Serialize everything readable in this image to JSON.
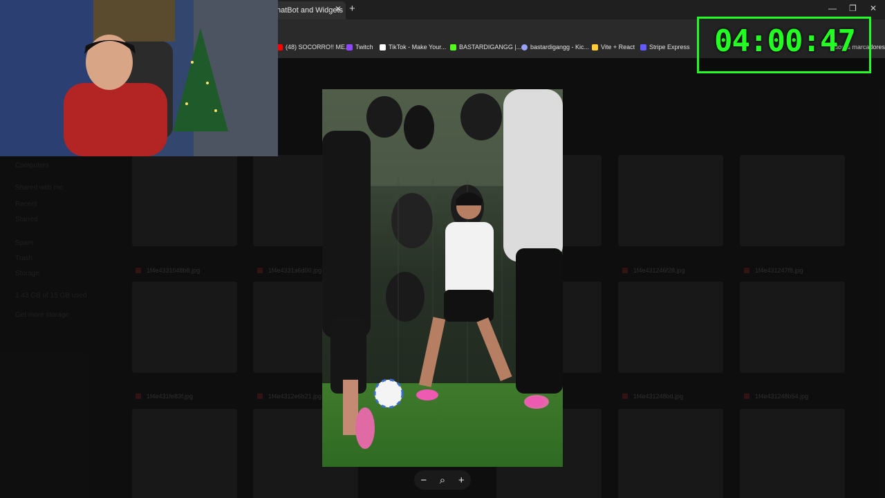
{
  "browser": {
    "active_tab_title": "hatBot and Widgets",
    "tab_close_glyph": "✕",
    "new_tab_glyph": "+",
    "window_controls": [
      "—",
      "❐",
      "✕"
    ],
    "bookmarks": [
      {
        "label": "(48) SOCORRO!! ME...",
        "icon": "youtube-icon",
        "color": "#ff0000"
      },
      {
        "label": "Twitch",
        "icon": "twitch-icon",
        "color": "#9146ff"
      },
      {
        "label": "TikTok - Make Your...",
        "icon": "tiktok-icon",
        "color": "#ffffff"
      },
      {
        "label": "BASTARDIGANGG |...",
        "icon": "kick-icon",
        "color": "#53fc18"
      },
      {
        "label": "bastardigangg - Kic...",
        "icon": "gear-icon",
        "color": "#9aa0ff"
      },
      {
        "label": "Vite + React",
        "icon": "vite-icon",
        "color": "#ffcc33"
      },
      {
        "label": "Stripe Express",
        "icon": "stripe-icon",
        "color": "#635bff"
      }
    ],
    "bookmark_overflow_label": "ados & marcadores"
  },
  "drive": {
    "sidebar": [
      "Computers",
      "Shared with me",
      "Recent",
      "Starred",
      "Spam",
      "Trash",
      "Storage",
      "1.43 GB of 15 GB used",
      "Get more storage"
    ],
    "file_names": [
      "1f4e4331048b8.jpg",
      "1f4e4331a6d00.jpg",
      "",
      "",
      "1f4e431246f28.jpg",
      "1f4e431247f8.jpg",
      "1f4e431fe83f.jpg",
      "1f4e4312e6b21.jpg",
      "",
      "",
      "1f4e431248bd.jpg",
      "1f4e431248b54.jpg"
    ]
  },
  "viewer": {
    "zoom_out_glyph": "−",
    "zoom_glyph": "⌕",
    "zoom_in_glyph": "+"
  },
  "timer": {
    "value": "04:00:47",
    "color": "#23ff23"
  }
}
